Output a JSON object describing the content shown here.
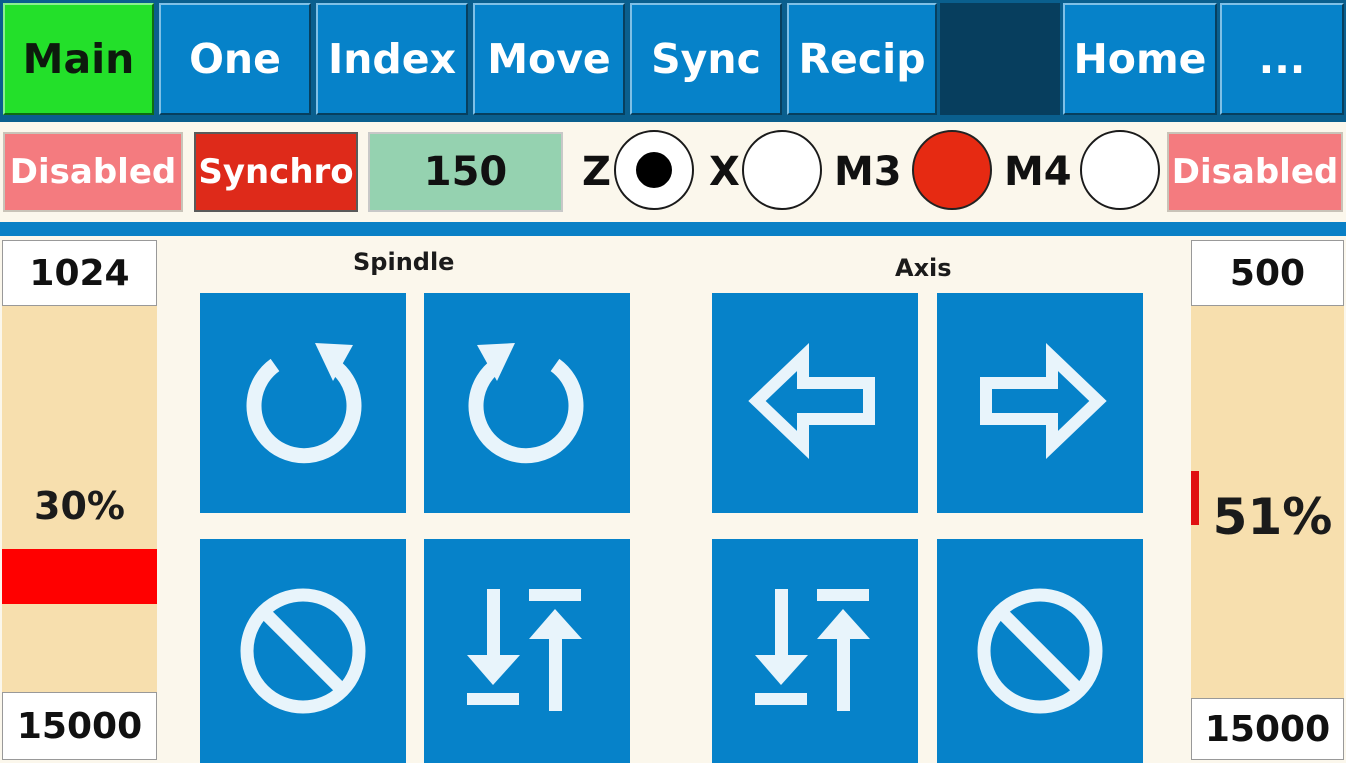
{
  "tabs": [
    {
      "label": "Main",
      "active": true
    },
    {
      "label": "One"
    },
    {
      "label": "Index"
    },
    {
      "label": "Move"
    },
    {
      "label": "Sync"
    },
    {
      "label": "Recip"
    },
    {
      "label": ""
    },
    {
      "label": "Home"
    },
    {
      "label": "..."
    }
  ],
  "status": {
    "left_state": "Disabled",
    "mode": "Synchro",
    "value": "150",
    "right_state": "Disabled",
    "axes": [
      {
        "label": "Z",
        "state": "selected"
      },
      {
        "label": "X",
        "state": "unselected"
      },
      {
        "label": "M3",
        "state": "active-red"
      },
      {
        "label": "M4",
        "state": "unselected"
      }
    ]
  },
  "left_gauge": {
    "top_value": "1024",
    "percent_label": "30%",
    "percent": 30,
    "bottom_value": "15000",
    "indicator_color": "#ff0000"
  },
  "right_gauge": {
    "top_value": "500",
    "percent_label": "51%",
    "percent": 51,
    "bottom_value": "15000",
    "indicator_color": "#e01010"
  },
  "spindle": {
    "label": "Spindle",
    "buttons": [
      {
        "icon": "rotate-ccw-icon"
      },
      {
        "icon": "rotate-cw-icon"
      },
      {
        "icon": "stop-icon"
      },
      {
        "icon": "up-down-limit-icon"
      }
    ]
  },
  "axis": {
    "label": "Axis",
    "buttons": [
      {
        "icon": "arrow-left-icon"
      },
      {
        "icon": "arrow-right-icon"
      },
      {
        "icon": "up-down-limit-icon"
      },
      {
        "icon": "stop-icon"
      }
    ]
  },
  "colors": {
    "accent": "#0682c9",
    "active_tab": "#23e02a",
    "disabled": "#f47b7f",
    "synchro": "#de2a1a",
    "value_bg": "#95d2b0",
    "gauge_bg": "#f7dfae",
    "background": "#fbf7ec"
  }
}
